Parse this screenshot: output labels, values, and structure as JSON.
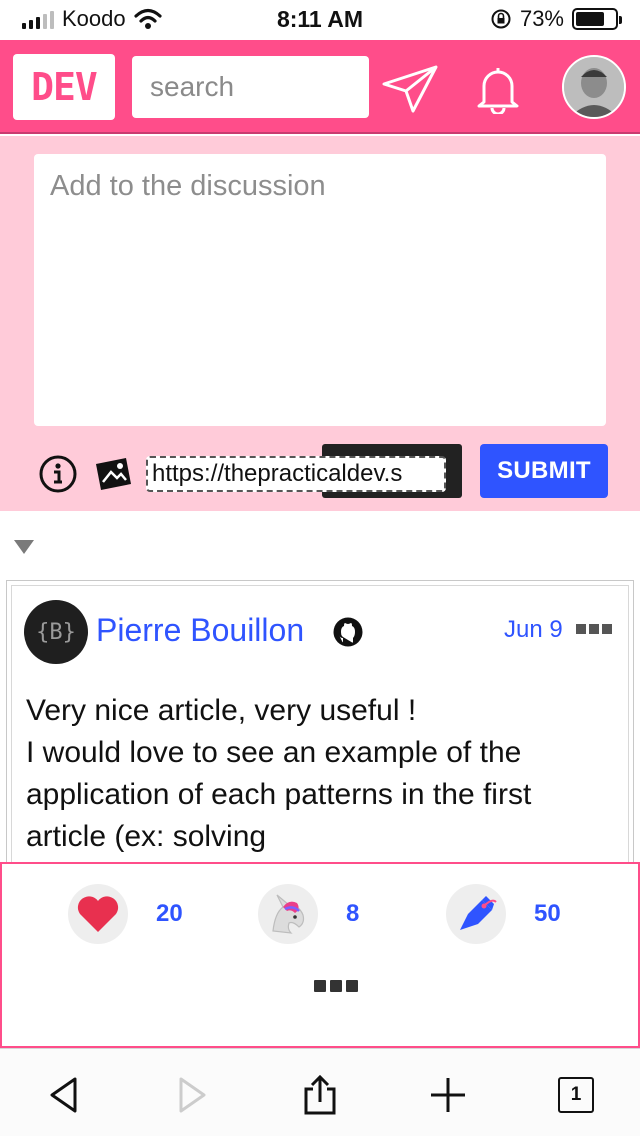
{
  "status_bar": {
    "carrier": "Koodo",
    "time": "8:11 AM",
    "battery": "73%",
    "battery_level": 0.73
  },
  "header": {
    "logo_text": "DEV",
    "search_placeholder": "search",
    "icons": [
      "send-icon",
      "bell-icon"
    ]
  },
  "composer": {
    "placeholder": "Add to the discussion",
    "image_url": "https://thepracticaldev.s",
    "submit_label": "SUBMIT"
  },
  "comment": {
    "avatar_text": "{B}",
    "author": "Pierre Bouillon",
    "date": "Jun 9",
    "body_lines": [
      "Very nice article, very useful !",
      "I would love to see an example of the",
      "application of each patterns in the first",
      "article (ex: solving"
    ]
  },
  "reactions": {
    "items": [
      {
        "name": "heart",
        "count": "20"
      },
      {
        "name": "unicorn",
        "count": "8"
      },
      {
        "name": "bookmark",
        "count": "50"
      }
    ]
  },
  "toolbar": {
    "tab_count": "1"
  },
  "colors": {
    "brand_pink": "#ff4d8a",
    "composer_bg": "#ffcbd9",
    "accent_blue": "#2f54ff"
  }
}
